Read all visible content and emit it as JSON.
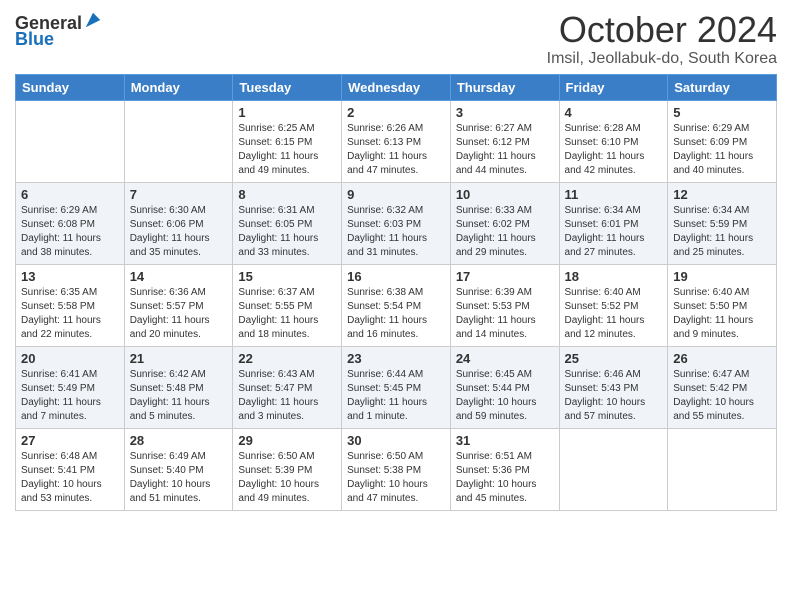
{
  "header": {
    "logo_line1": "General",
    "logo_line2": "Blue",
    "month_title": "October 2024",
    "subtitle": "Imsil, Jeollabuk-do, South Korea"
  },
  "weekdays": [
    "Sunday",
    "Monday",
    "Tuesday",
    "Wednesday",
    "Thursday",
    "Friday",
    "Saturday"
  ],
  "weeks": [
    [
      {
        "day": "",
        "info": ""
      },
      {
        "day": "",
        "info": ""
      },
      {
        "day": "1",
        "info": "Sunrise: 6:25 AM\nSunset: 6:15 PM\nDaylight: 11 hours and 49 minutes."
      },
      {
        "day": "2",
        "info": "Sunrise: 6:26 AM\nSunset: 6:13 PM\nDaylight: 11 hours and 47 minutes."
      },
      {
        "day": "3",
        "info": "Sunrise: 6:27 AM\nSunset: 6:12 PM\nDaylight: 11 hours and 44 minutes."
      },
      {
        "day": "4",
        "info": "Sunrise: 6:28 AM\nSunset: 6:10 PM\nDaylight: 11 hours and 42 minutes."
      },
      {
        "day": "5",
        "info": "Sunrise: 6:29 AM\nSunset: 6:09 PM\nDaylight: 11 hours and 40 minutes."
      }
    ],
    [
      {
        "day": "6",
        "info": "Sunrise: 6:29 AM\nSunset: 6:08 PM\nDaylight: 11 hours and 38 minutes."
      },
      {
        "day": "7",
        "info": "Sunrise: 6:30 AM\nSunset: 6:06 PM\nDaylight: 11 hours and 35 minutes."
      },
      {
        "day": "8",
        "info": "Sunrise: 6:31 AM\nSunset: 6:05 PM\nDaylight: 11 hours and 33 minutes."
      },
      {
        "day": "9",
        "info": "Sunrise: 6:32 AM\nSunset: 6:03 PM\nDaylight: 11 hours and 31 minutes."
      },
      {
        "day": "10",
        "info": "Sunrise: 6:33 AM\nSunset: 6:02 PM\nDaylight: 11 hours and 29 minutes."
      },
      {
        "day": "11",
        "info": "Sunrise: 6:34 AM\nSunset: 6:01 PM\nDaylight: 11 hours and 27 minutes."
      },
      {
        "day": "12",
        "info": "Sunrise: 6:34 AM\nSunset: 5:59 PM\nDaylight: 11 hours and 25 minutes."
      }
    ],
    [
      {
        "day": "13",
        "info": "Sunrise: 6:35 AM\nSunset: 5:58 PM\nDaylight: 11 hours and 22 minutes."
      },
      {
        "day": "14",
        "info": "Sunrise: 6:36 AM\nSunset: 5:57 PM\nDaylight: 11 hours and 20 minutes."
      },
      {
        "day": "15",
        "info": "Sunrise: 6:37 AM\nSunset: 5:55 PM\nDaylight: 11 hours and 18 minutes."
      },
      {
        "day": "16",
        "info": "Sunrise: 6:38 AM\nSunset: 5:54 PM\nDaylight: 11 hours and 16 minutes."
      },
      {
        "day": "17",
        "info": "Sunrise: 6:39 AM\nSunset: 5:53 PM\nDaylight: 11 hours and 14 minutes."
      },
      {
        "day": "18",
        "info": "Sunrise: 6:40 AM\nSunset: 5:52 PM\nDaylight: 11 hours and 12 minutes."
      },
      {
        "day": "19",
        "info": "Sunrise: 6:40 AM\nSunset: 5:50 PM\nDaylight: 11 hours and 9 minutes."
      }
    ],
    [
      {
        "day": "20",
        "info": "Sunrise: 6:41 AM\nSunset: 5:49 PM\nDaylight: 11 hours and 7 minutes."
      },
      {
        "day": "21",
        "info": "Sunrise: 6:42 AM\nSunset: 5:48 PM\nDaylight: 11 hours and 5 minutes."
      },
      {
        "day": "22",
        "info": "Sunrise: 6:43 AM\nSunset: 5:47 PM\nDaylight: 11 hours and 3 minutes."
      },
      {
        "day": "23",
        "info": "Sunrise: 6:44 AM\nSunset: 5:45 PM\nDaylight: 11 hours and 1 minute."
      },
      {
        "day": "24",
        "info": "Sunrise: 6:45 AM\nSunset: 5:44 PM\nDaylight: 10 hours and 59 minutes."
      },
      {
        "day": "25",
        "info": "Sunrise: 6:46 AM\nSunset: 5:43 PM\nDaylight: 10 hours and 57 minutes."
      },
      {
        "day": "26",
        "info": "Sunrise: 6:47 AM\nSunset: 5:42 PM\nDaylight: 10 hours and 55 minutes."
      }
    ],
    [
      {
        "day": "27",
        "info": "Sunrise: 6:48 AM\nSunset: 5:41 PM\nDaylight: 10 hours and 53 minutes."
      },
      {
        "day": "28",
        "info": "Sunrise: 6:49 AM\nSunset: 5:40 PM\nDaylight: 10 hours and 51 minutes."
      },
      {
        "day": "29",
        "info": "Sunrise: 6:50 AM\nSunset: 5:39 PM\nDaylight: 10 hours and 49 minutes."
      },
      {
        "day": "30",
        "info": "Sunrise: 6:50 AM\nSunset: 5:38 PM\nDaylight: 10 hours and 47 minutes."
      },
      {
        "day": "31",
        "info": "Sunrise: 6:51 AM\nSunset: 5:36 PM\nDaylight: 10 hours and 45 minutes."
      },
      {
        "day": "",
        "info": ""
      },
      {
        "day": "",
        "info": ""
      }
    ]
  ]
}
